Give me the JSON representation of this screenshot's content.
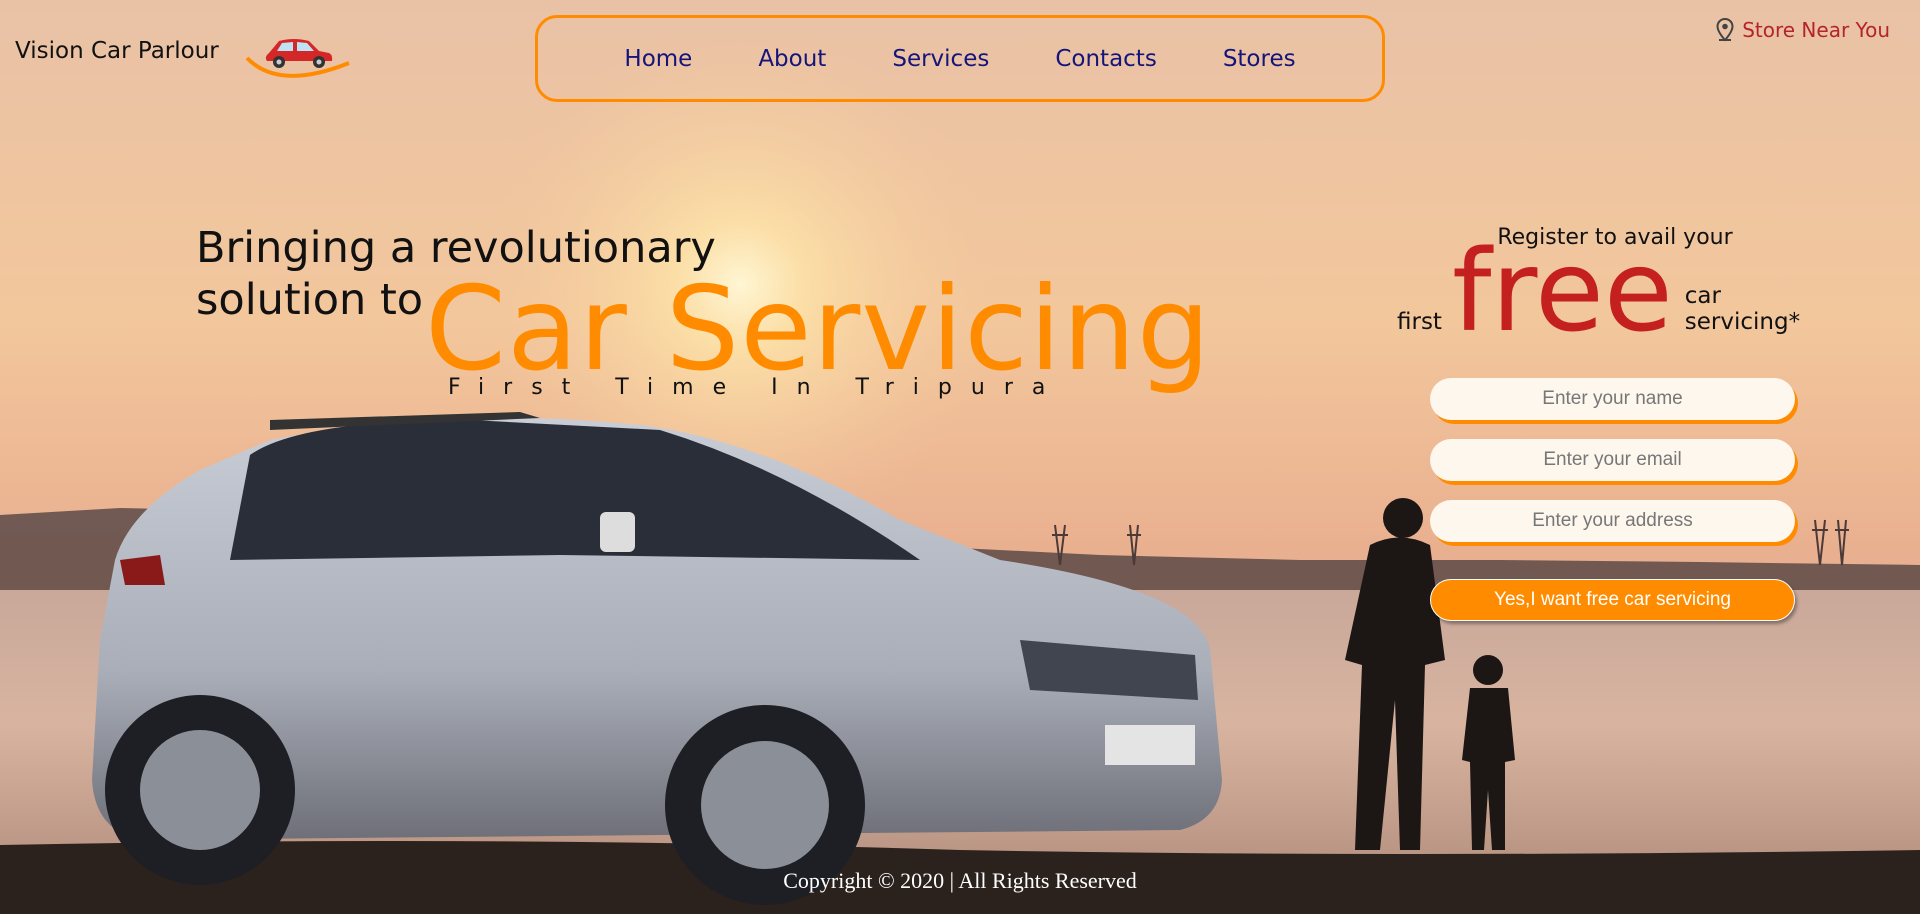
{
  "brand": {
    "name": "Vision Car Parlour",
    "logo_icon": "car-icon"
  },
  "nav": {
    "items": [
      "Home",
      "About",
      "Services",
      "Contacts",
      "Stores"
    ]
  },
  "store_link": {
    "label": "Store Near You",
    "icon": "location-pin-icon"
  },
  "hero": {
    "line1": "Bringing a revolutionary",
    "line2": "solution to",
    "highlight": "Car Servicing",
    "tagline": "First Time In Tripura"
  },
  "register": {
    "heading": "Register to avail your",
    "first": "first",
    "free": "free",
    "suffix": "car servicing*",
    "fields": {
      "name_placeholder": "Enter your name",
      "email_placeholder": "Enter your email",
      "address_placeholder": "Enter your address"
    },
    "submit_label": "Yes,I want free car servicing"
  },
  "footer": {
    "copyright": "Copyright © 2020 | All Rights Reserved"
  },
  "colors": {
    "accent": "#ff8c00",
    "free_red": "#c42020",
    "nav_text": "#14147a",
    "store_red": "#b3252a"
  }
}
